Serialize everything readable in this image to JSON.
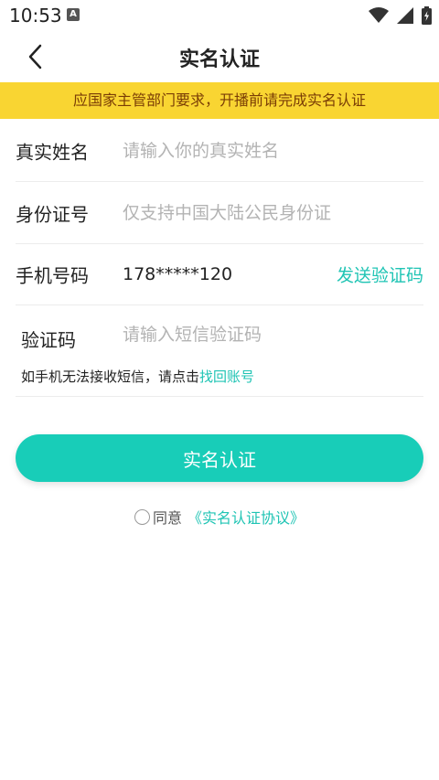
{
  "status_bar": {
    "time": "10:53",
    "notification_badge": "A",
    "icons": [
      "wifi-icon",
      "signal-icon",
      "battery-charging-icon"
    ]
  },
  "header": {
    "title": "实名认证",
    "back_icon": "chevron-left-icon"
  },
  "notice": {
    "text": "应国家主管部门要求，开播前请完成实名认证"
  },
  "form": {
    "name": {
      "label": "真实姓名",
      "placeholder": "请输入你的真实姓名"
    },
    "id_number": {
      "label": "身份证号",
      "placeholder": "仅支持中国大陆公民身份证"
    },
    "phone": {
      "label": "手机号码",
      "value": "178*****120",
      "send_code": "发送验证码"
    },
    "code": {
      "label": "验证码",
      "placeholder": "请输入短信验证码"
    },
    "hint": {
      "text": "如手机无法接收短信，请点击",
      "link": "找回账号"
    }
  },
  "submit": {
    "label": "实名认证"
  },
  "agreement": {
    "text": "同意",
    "link": "《实名认证协议》"
  },
  "colors": {
    "accent": "#18cdb8",
    "notice_bg": "#f9d532",
    "notice_text": "#7a3d05"
  }
}
